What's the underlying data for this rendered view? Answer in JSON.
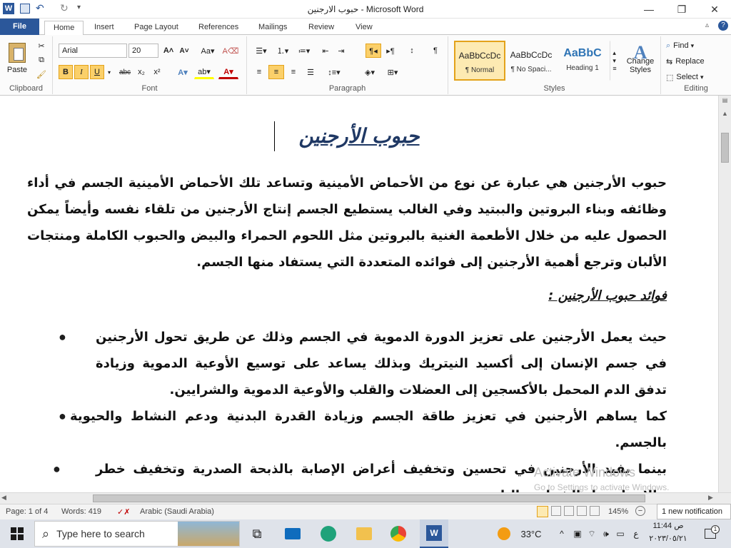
{
  "window": {
    "title": "حبوب الارجنين - Microsoft Word"
  },
  "ribbon": {
    "tabs": [
      "File",
      "Home",
      "Insert",
      "Page Layout",
      "References",
      "Mailings",
      "Review",
      "View"
    ],
    "clipboard": {
      "paste": "Paste",
      "label": "Clipboard"
    },
    "font": {
      "name": "Arial",
      "size": "20",
      "label": "Font"
    },
    "paragraph": {
      "label": "Paragraph"
    },
    "styles": {
      "label": "Styles",
      "items": [
        {
          "preview": "AaBbCcDc",
          "name": "¶ Normal"
        },
        {
          "preview": "AaBbCcDc",
          "name": "¶ No Spaci..."
        },
        {
          "preview": "AaBbC",
          "name": "Heading 1"
        }
      ],
      "change": "Change Styles"
    },
    "editing": {
      "label": "Editing",
      "find": "Find",
      "replace": "Replace",
      "select": "Select"
    }
  },
  "document": {
    "title": "حبوب الأرجنين",
    "paragraph1": "حبوب الأرجنين هي عبارة عن نوع من الأحماض الأمينية وتساعد تلك الأحماض الأمينية الجسم في أداء وظائفه وبناء البروتين والببتيد وفي الغالب يستطيع الجسم إنتاج الأرجنين من تلقاء نفسه وأيضاً يمكن الحصول عليه من خلال الأطعمة الغنية بالبروتين مثل اللحوم الحمراء والبيض والحبوب الكاملة ومنتجات الألبان وترجع أهمية الأرجنين إلى فوائده المتعددة التي يستفاد منها الجسم.",
    "subheading": "فوائد حبوب الأرجنين :",
    "bullets": [
      "حيث يعمل الأرجنين على تعزيز الدورة الدموية في الجسم وذلك عن طريق تحول الأرجنين في جسم الإنسان إلى أكسيد النيتريك وبذلك يساعد على توسيع الأوعية الدموية وزيادة تدفق الدم المحمل بالأكسجين إلى العضلات والقلب والأوعية الدموية والشرايين.",
      "كما يساهم الأرجنين في تعزيز طاقة الجسم وزيادة القدرة البدنية ودعم النشاط والحيوية بالجسم.",
      "بينما يفيد الأرجنين في تحسين وتخفيف أعراض الإصابة بالذبحة الصدرية وتخفيف خطر حالات انسداد الشرايين التاجية."
    ],
    "activate_watermark": "Activate Windows",
    "activate_sub": "Go to Settings to activate Windows."
  },
  "statusbar": {
    "page": "Page: 1 of 4",
    "words": "Words: 419",
    "language": "Arabic (Saudi Arabia)",
    "zoom": "145%",
    "notification": "1 new notification"
  },
  "taskbar": {
    "search_placeholder": "Type here to search",
    "weather": "33°C",
    "time": "11:44 ص",
    "date": "٢٠٢٣/٠٥/٢١",
    "lang": "ع"
  }
}
